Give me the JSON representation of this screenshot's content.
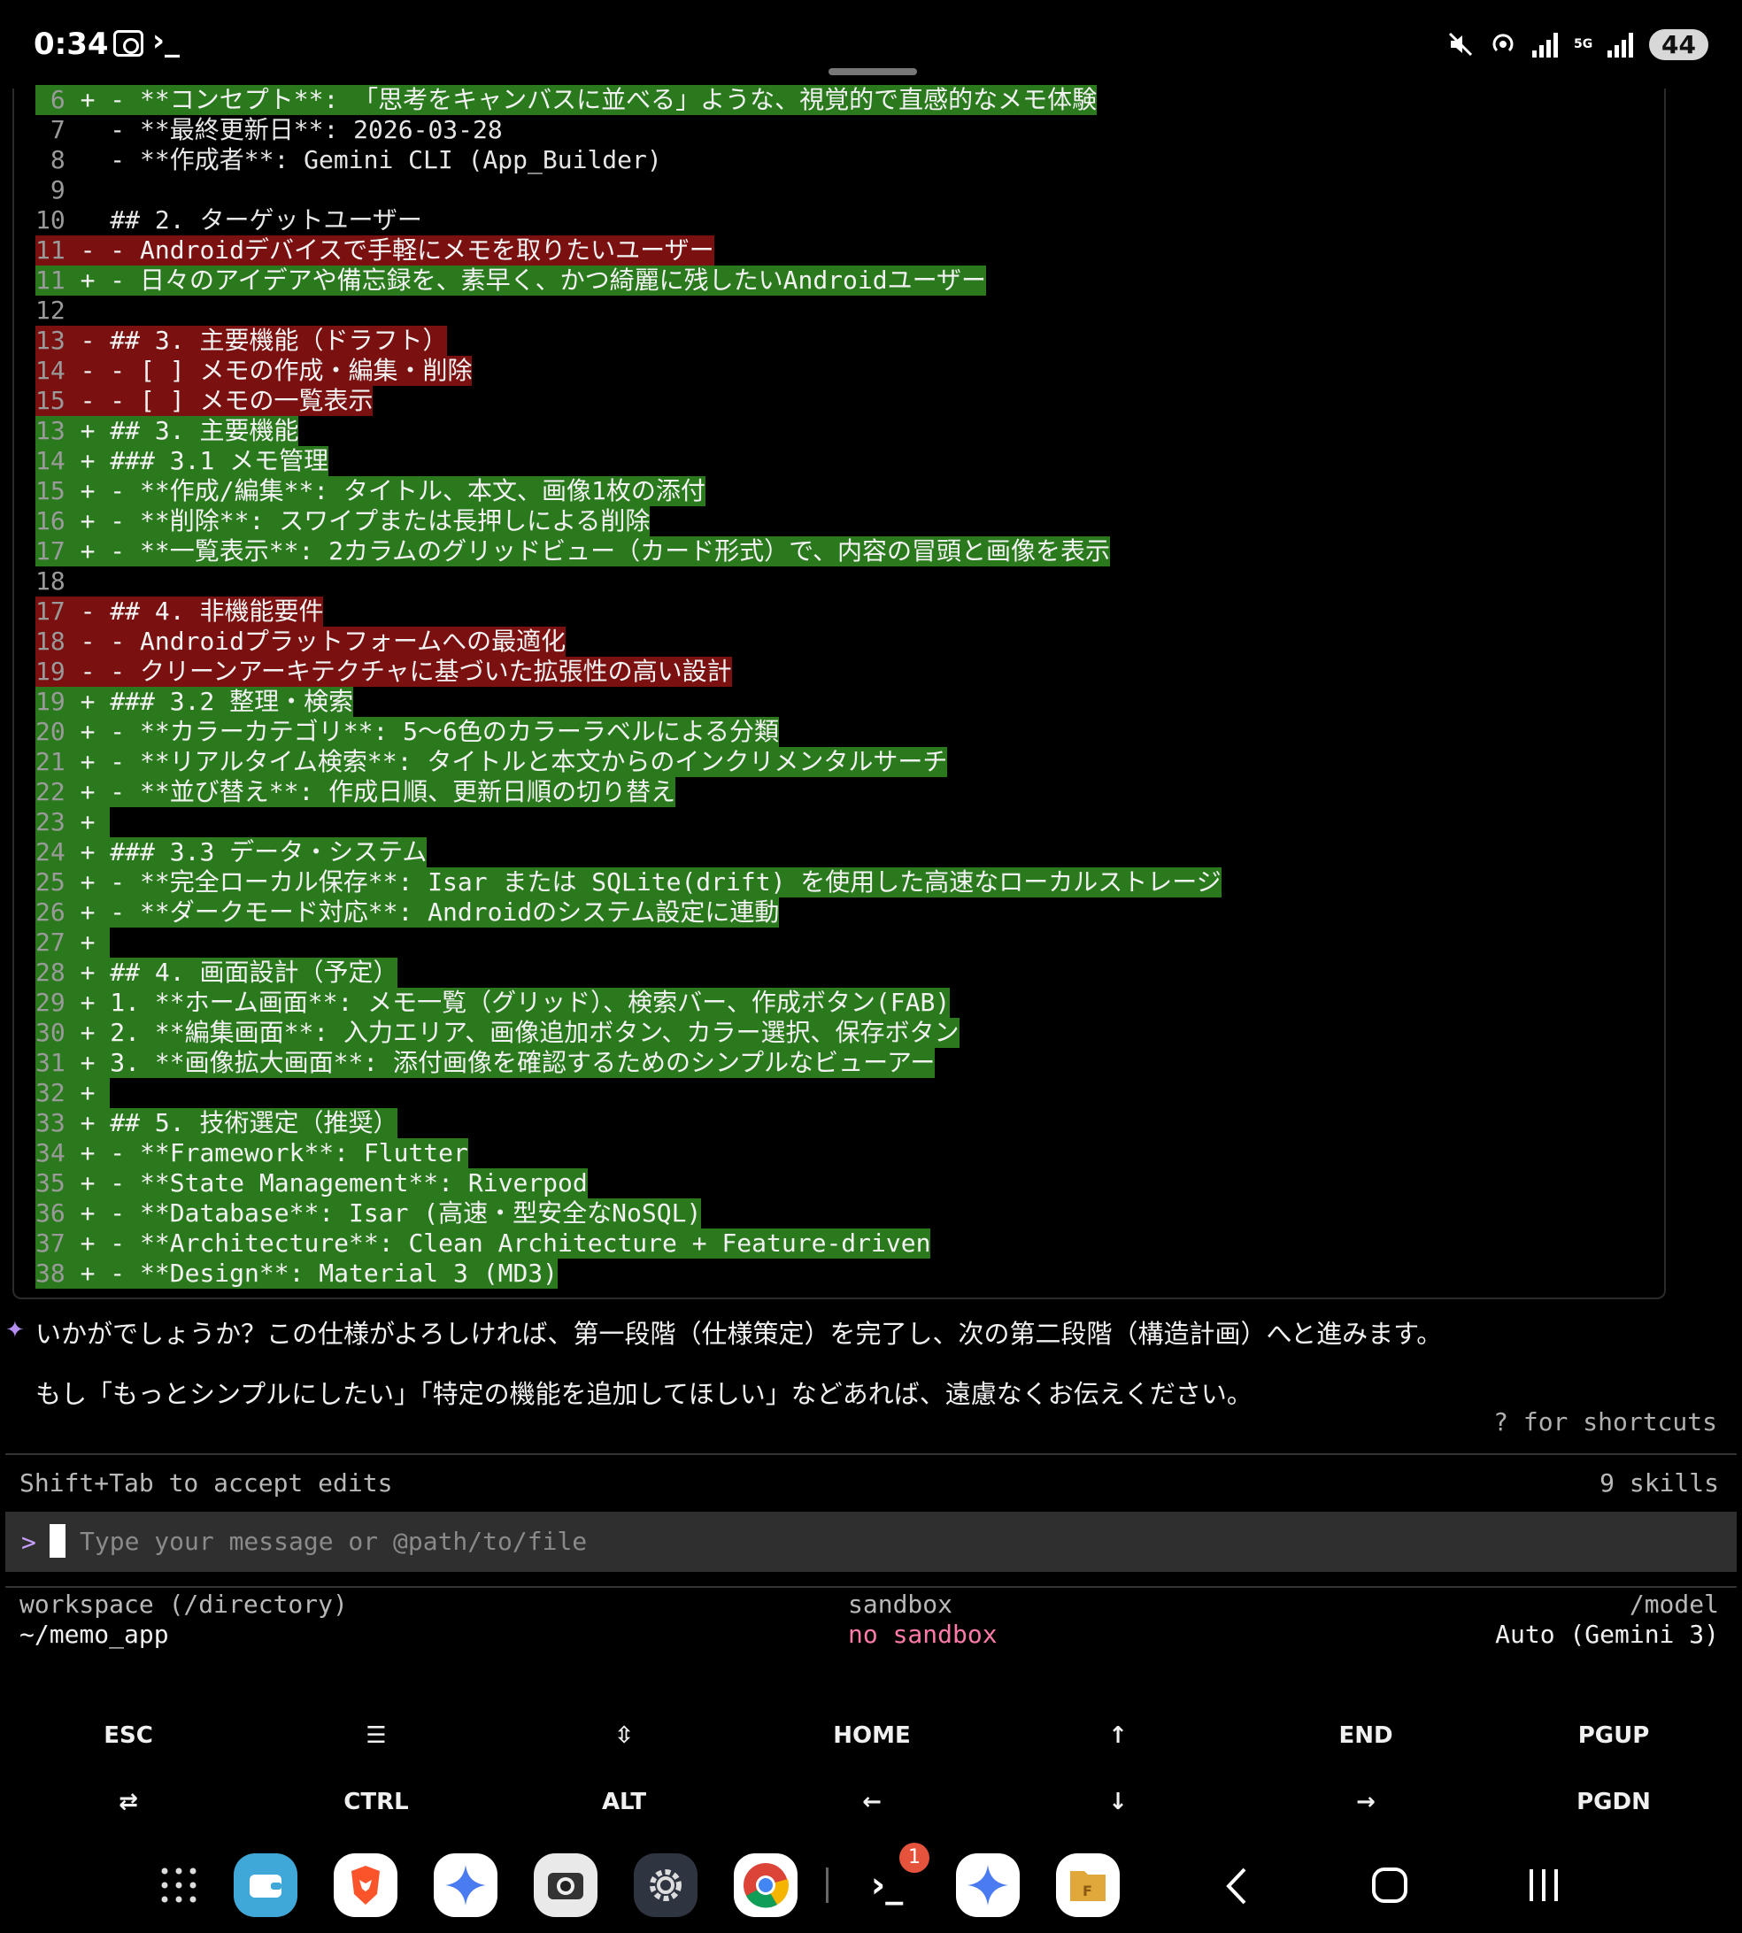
{
  "status_bar": {
    "time": "0:34",
    "terminal_glyph": "›_",
    "network": "5G",
    "battery": "44"
  },
  "diff": [
    {
      "type": "add",
      "num": "6",
      "sign": "+",
      "text": "- **コンセプト**: 「思考をキャンバスに並べる」ような、視覚的で直感的なメモ体験"
    },
    {
      "type": "ctx",
      "num": "7",
      "sign": " ",
      "text": "- **最終更新日**: 2026-03-28"
    },
    {
      "type": "ctx",
      "num": "8",
      "sign": " ",
      "text": "- **作成者**: Gemini CLI (App_Builder)"
    },
    {
      "type": "ctx",
      "num": "9",
      "sign": " ",
      "text": ""
    },
    {
      "type": "ctx",
      "num": "10",
      "sign": " ",
      "text": "## 2. ターゲットユーザー"
    },
    {
      "type": "del",
      "num": "11",
      "sign": "-",
      "text": "- Androidデバイスで手軽にメモを取りたいユーザー"
    },
    {
      "type": "add",
      "num": "11",
      "sign": "+",
      "text": "- 日々のアイデアや備忘録を、素早く、かつ綺麗に残したいAndroidユーザー"
    },
    {
      "type": "ctx",
      "num": "12",
      "sign": " ",
      "text": ""
    },
    {
      "type": "del",
      "num": "13",
      "sign": "-",
      "text": "## 3. 主要機能（ドラフト）"
    },
    {
      "type": "del",
      "num": "14",
      "sign": "-",
      "text": "- [ ] メモの作成・編集・削除"
    },
    {
      "type": "del",
      "num": "15",
      "sign": "-",
      "text": "- [ ] メモの一覧表示"
    },
    {
      "type": "add",
      "num": "13",
      "sign": "+",
      "text": "## 3. 主要機能"
    },
    {
      "type": "add",
      "num": "14",
      "sign": "+",
      "text": "### 3.1 メモ管理"
    },
    {
      "type": "add",
      "num": "15",
      "sign": "+",
      "text": "- **作成/編集**: タイトル、本文、画像1枚の添付"
    },
    {
      "type": "add",
      "num": "16",
      "sign": "+",
      "text": "- **削除**: スワイプまたは長押しによる削除"
    },
    {
      "type": "add",
      "num": "17",
      "sign": "+",
      "text": "- **一覧表示**: 2カラムのグリッドビュー（カード形式）で、内容の冒頭と画像を表示"
    },
    {
      "type": "ctx",
      "num": "18",
      "sign": " ",
      "text": ""
    },
    {
      "type": "del",
      "num": "17",
      "sign": "-",
      "text": "## 4. 非機能要件"
    },
    {
      "type": "del",
      "num": "18",
      "sign": "-",
      "text": "- Androidプラットフォームへの最適化"
    },
    {
      "type": "del",
      "num": "19",
      "sign": "-",
      "text": "- クリーンアーキテクチャに基づいた拡張性の高い設計"
    },
    {
      "type": "add",
      "num": "19",
      "sign": "+",
      "text": "### 3.2 整理・検索"
    },
    {
      "type": "add",
      "num": "20",
      "sign": "+",
      "text": "- **カラーカテゴリ**: 5〜6色のカラーラベルによる分類"
    },
    {
      "type": "add",
      "num": "21",
      "sign": "+",
      "text": "- **リアルタイム検索**: タイトルと本文からのインクリメンタルサーチ"
    },
    {
      "type": "add",
      "num": "22",
      "sign": "+",
      "text": "- **並び替え**: 作成日順、更新日順の切り替え"
    },
    {
      "type": "add",
      "num": "23",
      "sign": "+",
      "text": ""
    },
    {
      "type": "add",
      "num": "24",
      "sign": "+",
      "text": "### 3.3 データ・システム"
    },
    {
      "type": "add",
      "num": "25",
      "sign": "+",
      "text": "- **完全ローカル保存**: Isar または SQLite(drift) を使用した高速なローカルストレージ"
    },
    {
      "type": "add",
      "num": "26",
      "sign": "+",
      "text": "- **ダークモード対応**: Androidのシステム設定に連動"
    },
    {
      "type": "add",
      "num": "27",
      "sign": "+",
      "text": ""
    },
    {
      "type": "add",
      "num": "28",
      "sign": "+",
      "text": "## 4. 画面設計（予定）"
    },
    {
      "type": "add",
      "num": "29",
      "sign": "+",
      "text": "1. **ホーム画面**: メモ一覧（グリッド）、検索バー、作成ボタン(FAB)"
    },
    {
      "type": "add",
      "num": "30",
      "sign": "+",
      "text": "2. **編集画面**: 入力エリア、画像追加ボタン、カラー選択、保存ボタン"
    },
    {
      "type": "add",
      "num": "31",
      "sign": "+",
      "text": "3. **画像拡大画面**: 添付画像を確認するためのシンプルなビューアー"
    },
    {
      "type": "add",
      "num": "32",
      "sign": "+",
      "text": ""
    },
    {
      "type": "add",
      "num": "33",
      "sign": "+",
      "text": "## 5. 技術選定（推奨）"
    },
    {
      "type": "add",
      "num": "34",
      "sign": "+",
      "text": "- **Framework**: Flutter"
    },
    {
      "type": "add",
      "num": "35",
      "sign": "+",
      "text": "- **State Management**: Riverpod"
    },
    {
      "type": "add",
      "num": "36",
      "sign": "+",
      "text": "- **Database**: Isar (高速・型安全なNoSQL)"
    },
    {
      "type": "add",
      "num": "37",
      "sign": "+",
      "text": "- **Architecture**: Clean Architecture + Feature-driven"
    },
    {
      "type": "add",
      "num": "38",
      "sign": "+",
      "text": "- **Design**: Material 3 (MD3)"
    }
  ],
  "message": {
    "line1": "いかがでしょうか？この仕様がよろしければ、第一段階（仕様策定）を完了し、次の第二段階（構造計画）へと進みます。",
    "line2": "もし「もっとシンプルにしたい」「特定の機能を追加してほしい」などあれば、遠慮なくお伝えください。"
  },
  "hints": {
    "shortcuts": "? for shortcuts",
    "accept_edits": "Shift+Tab to accept edits",
    "skills": "9 skills"
  },
  "input": {
    "prompt": ">",
    "placeholder": "Type your message or @path/to/file",
    "value": ""
  },
  "footer": {
    "workspace_label": "workspace (/directory)",
    "workspace_value": "~/memo_app",
    "sandbox_label": "sandbox",
    "sandbox_value": "no sandbox",
    "model_label": "/model",
    "model_value": "Auto (Gemini 3)"
  },
  "extra_keys": {
    "row1": [
      "ESC",
      "☰",
      "⇳",
      "HOME",
      "↑",
      "END",
      "PGUP"
    ],
    "row2": [
      "⇄",
      "CTRL",
      "ALT",
      "←",
      "↓",
      "→",
      "PGDN"
    ]
  },
  "dock": {
    "badge_count": "1"
  }
}
